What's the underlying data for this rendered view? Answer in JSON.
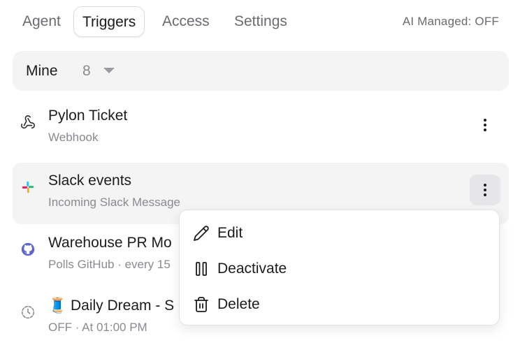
{
  "tabs": [
    {
      "label": "Agent"
    },
    {
      "label": "Triggers",
      "active": true
    },
    {
      "label": "Access"
    },
    {
      "label": "Settings"
    }
  ],
  "ai_status": "AI Managed: OFF",
  "filter": {
    "label": "Mine",
    "count": "8"
  },
  "triggers": [
    {
      "title": "Pylon Ticket",
      "subtitle": "Webhook",
      "icon": "webhook-icon"
    },
    {
      "title": "Slack events",
      "subtitle": "Incoming Slack Message",
      "icon": "slack-icon"
    },
    {
      "title": "Warehouse PR Mo",
      "subtitle": "Polls GitHub · every 15",
      "icon": "github-icon"
    },
    {
      "title": "🧵 Daily Dream - S",
      "subtitle": "OFF · At 01:00 PM",
      "icon": "clock-icon"
    }
  ],
  "context_menu": {
    "items": [
      {
        "label": "Edit",
        "icon": "pencil-icon"
      },
      {
        "label": "Deactivate",
        "icon": "pause-icon"
      },
      {
        "label": "Delete",
        "icon": "trash-icon"
      }
    ]
  },
  "colors": {
    "text": "#1c1c1e",
    "muted": "#8a8a8f",
    "hover_bg": "#f4f4f5",
    "slack_green": "#2eb67d",
    "slack_blue": "#36c5f0",
    "slack_red": "#e01e5a",
    "slack_yellow": "#ecb22e",
    "github_blue": "#5b67c9"
  }
}
